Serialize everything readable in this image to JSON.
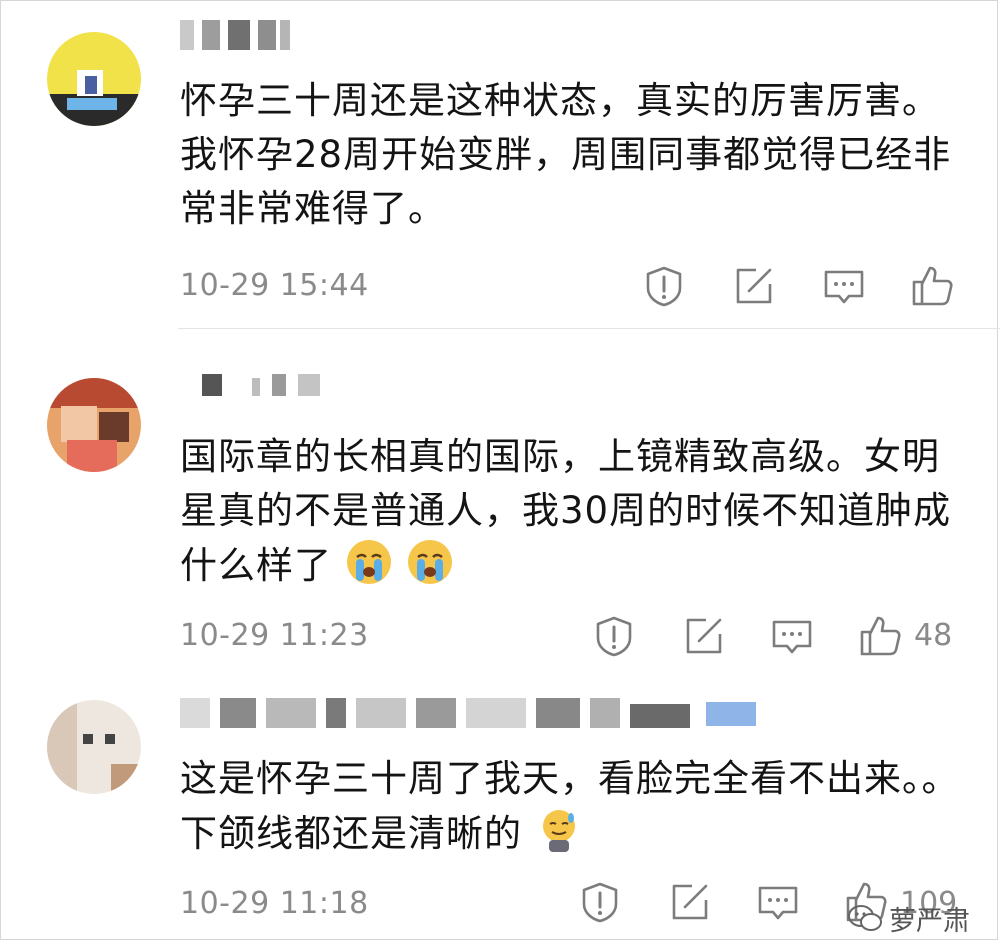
{
  "comments": [
    {
      "text": "怀孕三十周还是这种状态，真实的厉害厉害。我怀孕28周开始变胖，周围同事都觉得已经非常非常难得了。",
      "time": "10-29 15:44",
      "likes": ""
    },
    {
      "text": "国际章的长相真的国际，上镜精致高级。女明星真的不是普通人，我30周的时候不知道肿成什么样了",
      "time": "10-29 11:23",
      "likes": "48"
    },
    {
      "text": "这是怀孕三十周了我天，看脸完全看不出来。。下颌线都还是清晰的",
      "time": "10-29 11:18",
      "likes": "109"
    }
  ],
  "watermark": "萝严肃",
  "icons": {
    "report": "report-icon",
    "share": "share-icon",
    "reply": "comment-icon",
    "like": "thumbs-up-icon",
    "watermark": "wechat-icon"
  },
  "colors": {
    "icon": "#7c7c7c",
    "meta_text": "#8a8a8a",
    "body_text": "#141414"
  }
}
